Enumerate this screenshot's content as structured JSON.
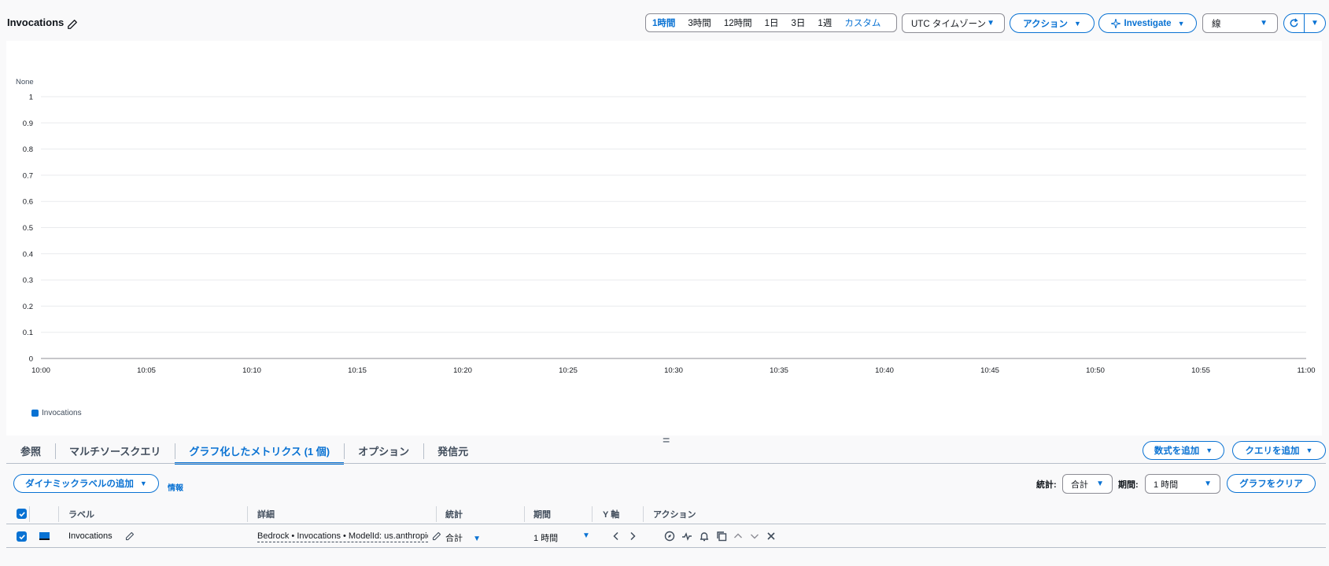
{
  "header": {
    "title": "Invocations",
    "time_ranges": [
      "1時間",
      "3時間",
      "12時間",
      "1日",
      "3日",
      "1週"
    ],
    "active_range": "1時間",
    "custom_label": "カスタム",
    "timezone_label": "UTC タイムゾーン",
    "actions_label": "アクション",
    "investigate_label": "Investigate",
    "graph_type_label": "線"
  },
  "chart_data": {
    "type": "line",
    "title": "",
    "ylabel": "None",
    "xlabel": "",
    "ylim": [
      0,
      1
    ],
    "y_ticks": [
      "0",
      "0.1",
      "0.2",
      "0.3",
      "0.4",
      "0.5",
      "0.6",
      "0.7",
      "0.8",
      "0.9",
      "1"
    ],
    "x": [
      "10:00",
      "10:05",
      "10:10",
      "10:15",
      "10:20",
      "10:25",
      "10:30",
      "10:35",
      "10:40",
      "10:45",
      "10:50",
      "10:55",
      "11:00"
    ],
    "series": [
      {
        "name": "Invocations",
        "values": [],
        "color": "#0972d3"
      }
    ],
    "grid": true,
    "legend_position": "bottom-left"
  },
  "tabs": [
    {
      "label": "参照",
      "active": false
    },
    {
      "label": "マルチソースクエリ",
      "active": false
    },
    {
      "label": "グラフ化したメトリクス (1 個)",
      "active": true
    },
    {
      "label": "オプション",
      "active": false
    },
    {
      "label": "発信元",
      "active": false
    }
  ],
  "toolbar": {
    "add_math_label": "数式を追加",
    "add_query_label": "クエリを追加",
    "dynamic_label_btn": "ダイナミックラベルの追加",
    "info_label": "情報",
    "stat_label": "統計:",
    "stat_value": "合計",
    "period_label": "期間:",
    "period_value": "1 時間",
    "clear_graph_label": "グラフをクリア"
  },
  "table": {
    "headers": {
      "label": "ラベル",
      "details": "詳細",
      "stat": "統計",
      "period": "期間",
      "yaxis": "Y 軸",
      "actions": "アクション"
    },
    "rows": [
      {
        "label": "Invocations",
        "details": "Bedrock • Invocations • ModelId: us.anthropic",
        "stat": "合計",
        "period": "1 時間",
        "color": "#0972d3"
      }
    ]
  }
}
